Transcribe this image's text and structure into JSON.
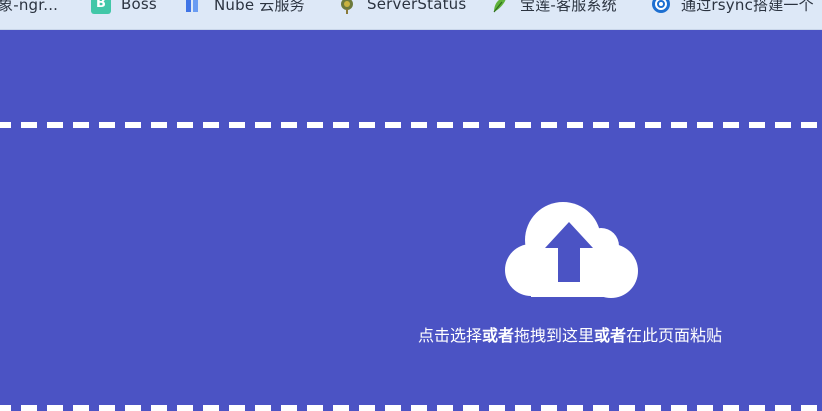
{
  "bookmarks_bar": {
    "items": [
      {
        "label": "象-ngr...",
        "icon": "page-icon"
      },
      {
        "label": "Boss",
        "icon": "boss-b-icon"
      },
      {
        "label": "Nube 云服务",
        "icon": "nube-logo-icon"
      },
      {
        "label": "ServerStatus",
        "icon": "server-status-icon"
      },
      {
        "label": "宝莲-客服系统",
        "icon": "leaf-icon"
      },
      {
        "label": "通过rsync搭建一个",
        "icon": "globe-logo-icon"
      }
    ]
  },
  "upload": {
    "icon": "cloud-upload-icon",
    "text_1": "点击选择",
    "text_2": "或者",
    "text_3": "拖拽到这里",
    "text_4": "或者",
    "text_5": "在此页面粘贴"
  },
  "colors": {
    "background": "#4b53c4",
    "dash": "#ffffff",
    "bookmarks_bar": "#dde8f7"
  }
}
